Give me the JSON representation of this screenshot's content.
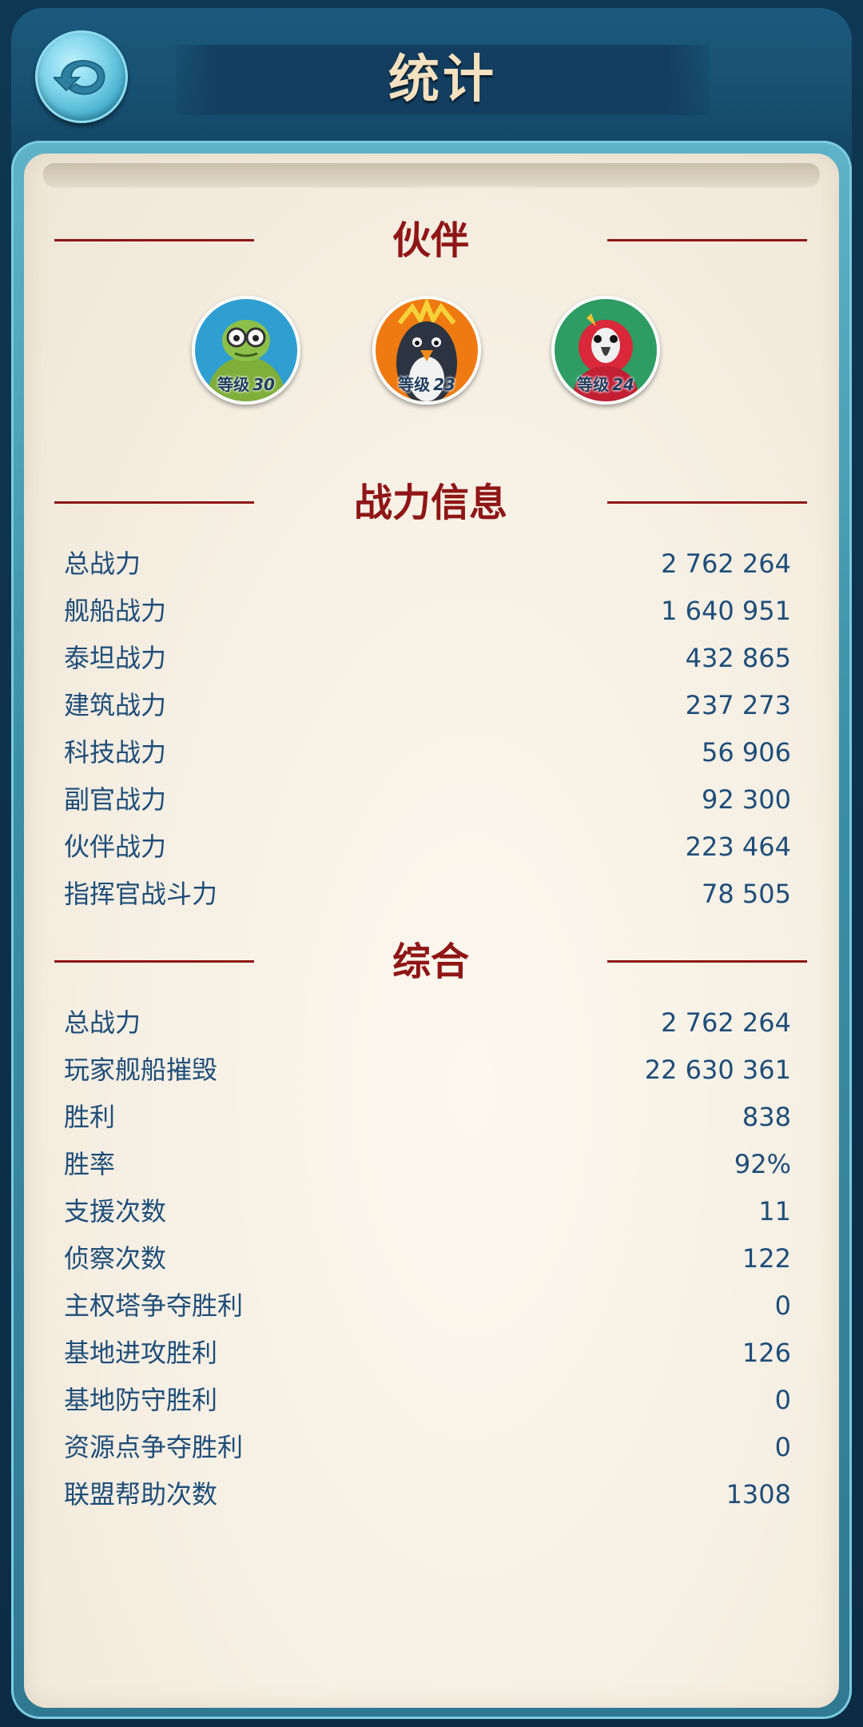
{
  "header": {
    "title": "统计"
  },
  "sections": {
    "partners": {
      "title": "伙伴",
      "items": [
        {
          "level_label": "等级",
          "level": "30",
          "icon": "turtle-partner-icon",
          "bg": "#2f9fd1"
        },
        {
          "level_label": "等级",
          "level": "23",
          "icon": "penguin-partner-icon",
          "bg": "#ef7a12"
        },
        {
          "level_label": "等级",
          "level": "24",
          "icon": "parrot-partner-icon",
          "bg": "#2e9c63"
        }
      ]
    },
    "combat": {
      "title": "战力信息",
      "rows": [
        {
          "name": "总战力",
          "value": "2 762 264"
        },
        {
          "name": "舰船战力",
          "value": "1 640 951"
        },
        {
          "name": "泰坦战力",
          "value": "432 865"
        },
        {
          "name": "建筑战力",
          "value": "237 273"
        },
        {
          "name": "科技战力",
          "value": "56 906"
        },
        {
          "name": "副官战力",
          "value": "92 300"
        },
        {
          "name": "伙伴战力",
          "value": "223 464"
        },
        {
          "name": "指挥官战斗力",
          "value": "78 505"
        }
      ]
    },
    "overall": {
      "title": "综合",
      "rows": [
        {
          "name": "总战力",
          "value": "2 762 264"
        },
        {
          "name": "玩家舰船摧毁",
          "value": "22 630 361"
        },
        {
          "name": "胜利",
          "value": "838"
        },
        {
          "name": "胜率",
          "value": "92%"
        },
        {
          "name": "支援次数",
          "value": "11"
        },
        {
          "name": "侦察次数",
          "value": "122"
        },
        {
          "name": "主权塔争夺胜利",
          "value": "0"
        },
        {
          "name": "基地进攻胜利",
          "value": "126"
        },
        {
          "name": "基地防守胜利",
          "value": "0"
        },
        {
          "name": "资源点争夺胜利",
          "value": "0"
        },
        {
          "name": "联盟帮助次数",
          "value": "1308"
        }
      ]
    }
  },
  "colors": {
    "accent_red": "#8f1616",
    "stat_text": "#1e4d79",
    "title_text": "#f5e1bf"
  }
}
